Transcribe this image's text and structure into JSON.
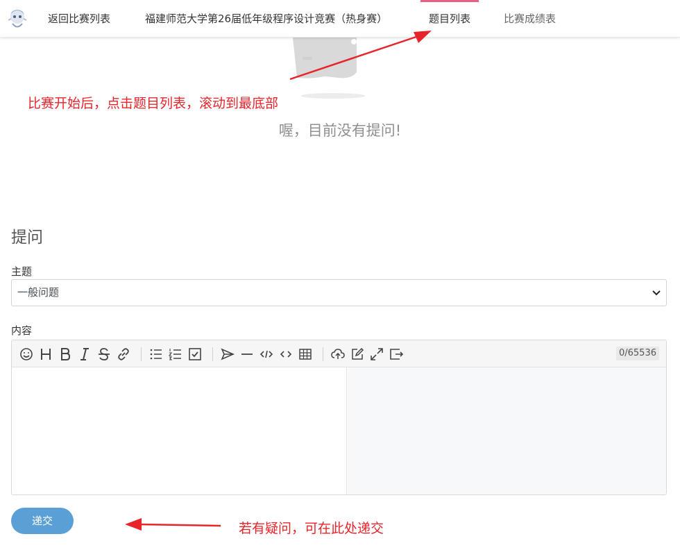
{
  "nav": {
    "back": "返回比赛列表",
    "contest_title": "福建师范大学第26届低年级程序设计竞赛（热身赛）",
    "problems": "题目列表",
    "scoreboard": "比赛成绩表"
  },
  "empty": {
    "message": "喔，目前没有提问!"
  },
  "annotations": {
    "top": "比赛开始后，点击题目列表，滚动到最底部",
    "bottom": "若有疑问，可在此处递交"
  },
  "form": {
    "title": "提问",
    "subject_label": "主题",
    "subject_value": "一般问题",
    "content_label": "内容",
    "counter": "0/65536",
    "submit": "递交"
  },
  "toolbar_icons": [
    "emoji-icon",
    "heading-icon",
    "bold-icon",
    "italic-icon",
    "strikethrough-icon",
    "link-icon",
    "unordered-list-icon",
    "ordered-list-icon",
    "checkbox-icon",
    "send-icon",
    "horizontal-rule-icon",
    "code-block-icon",
    "inline-code-icon",
    "table-icon",
    "upload-icon",
    "edit-icon",
    "fullscreen-icon",
    "preview-icon"
  ],
  "colors": {
    "accent": "#e6618a",
    "submit": "#5a9fd6",
    "annotation": "#e8242b"
  }
}
